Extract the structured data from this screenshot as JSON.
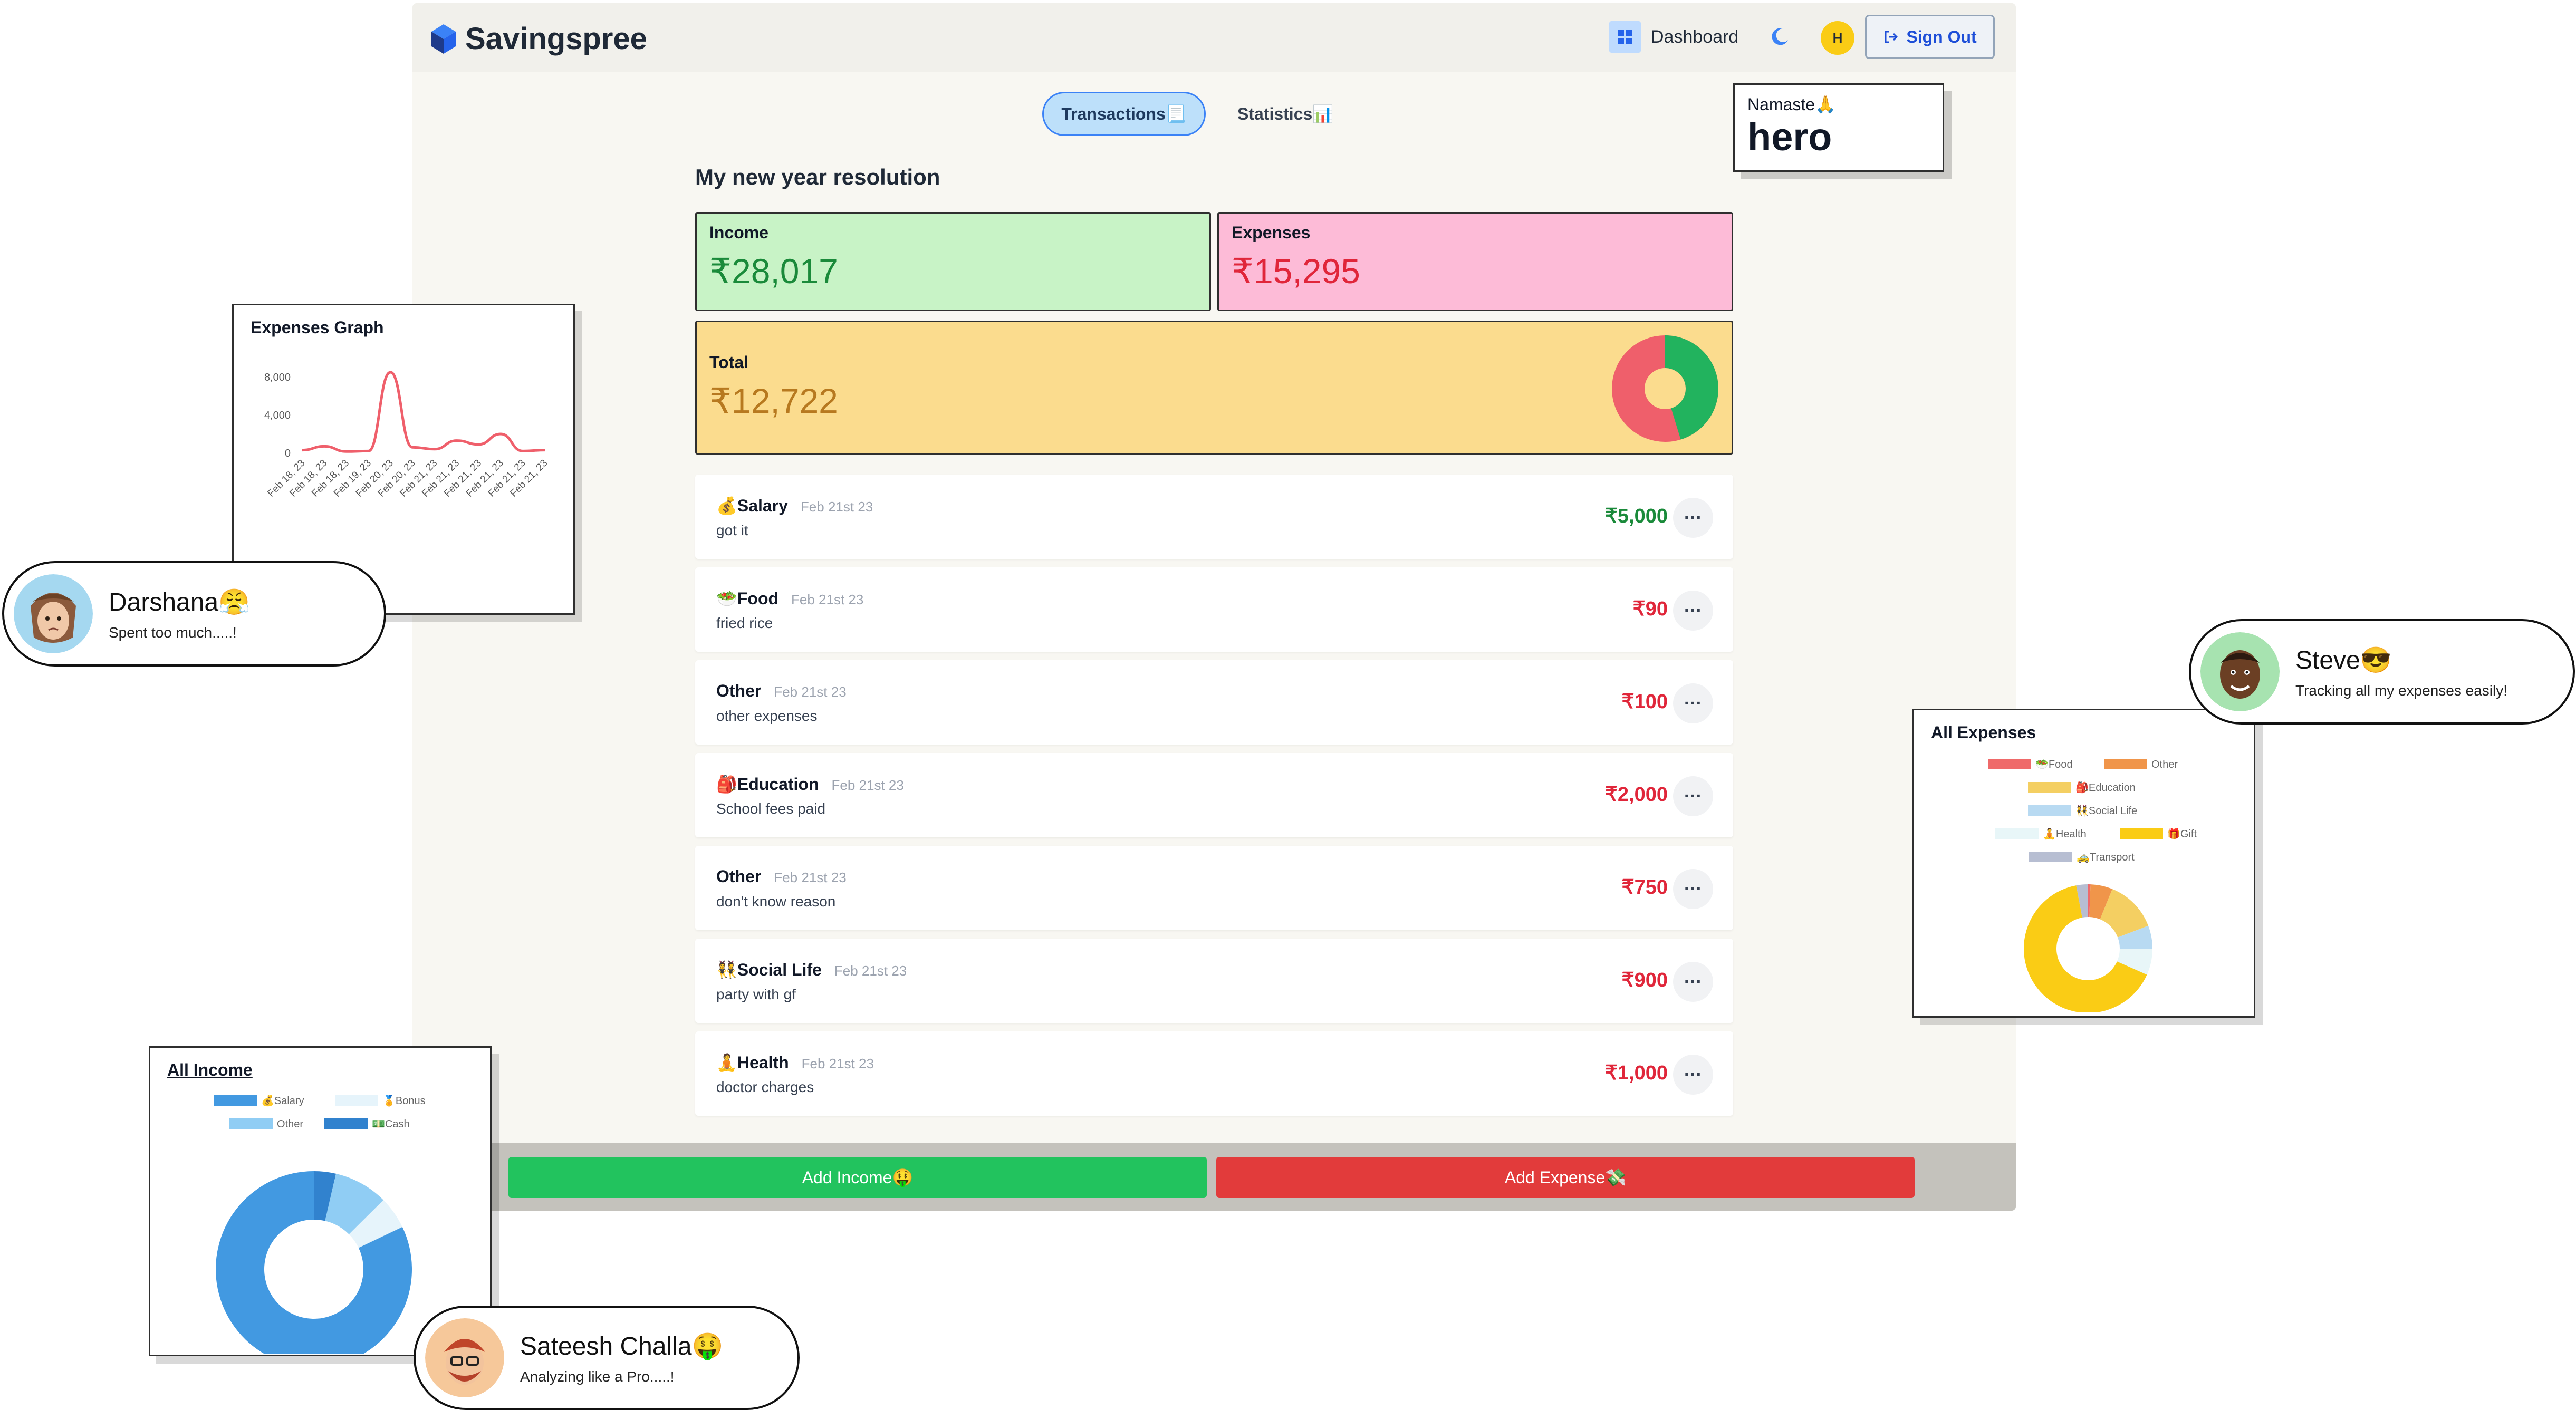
{
  "header": {
    "brand": "Savingspree",
    "dashboard_label": "Dashboard",
    "avatar_initial": "H",
    "signout_label": "Sign Out"
  },
  "tabs": [
    {
      "label": "Transactions📃",
      "active": true
    },
    {
      "label": "Statistics📊",
      "active": false
    }
  ],
  "greeting": {
    "label": "Namaste🙏",
    "name": "hero"
  },
  "page_title": "My new year resolution",
  "summary": {
    "income_label": "Income",
    "income_value": "₹28,017",
    "expenses_label": "Expenses",
    "expenses_value": "₹15,295",
    "total_label": "Total",
    "total_value": "₹12,722",
    "colors": {
      "income": "#1a8a3a",
      "expense": "#e0263a",
      "total": "#b7791f"
    }
  },
  "transactions": [
    {
      "name": "💰Salary",
      "date": "Feb 21st 23",
      "note": "got it",
      "amount": "₹5,000",
      "kind": "income"
    },
    {
      "name": "🥗Food",
      "date": "Feb 21st 23",
      "note": "fried rice",
      "amount": "₹90",
      "kind": "expense"
    },
    {
      "name": "Other",
      "date": "Feb 21st 23",
      "note": "other expenses",
      "amount": "₹100",
      "kind": "expense"
    },
    {
      "name": "🎒Education",
      "date": "Feb 21st 23",
      "note": "School fees paid",
      "amount": "₹2,000",
      "kind": "expense"
    },
    {
      "name": "Other",
      "date": "Feb 21st 23",
      "note": "don't know reason",
      "amount": "₹750",
      "kind": "expense"
    },
    {
      "name": "👯Social Life",
      "date": "Feb 21st 23",
      "note": "party with gf",
      "amount": "₹900",
      "kind": "expense"
    },
    {
      "name": "🧘Health",
      "date": "Feb 21st 23",
      "note": "doctor charges",
      "amount": "₹1,000",
      "kind": "expense"
    }
  ],
  "more_label": "···",
  "actions": {
    "add_income": "Add Income🤑",
    "add_expense": "Add Expense💸"
  },
  "expenses_graph": {
    "title": "Expenses Graph",
    "chart_data": {
      "type": "line",
      "title": "Expenses Graph",
      "x": [
        "Feb 18, 23",
        "Feb 18, 23",
        "Feb 18, 23",
        "Feb 19, 23",
        "Feb 20, 23",
        "Feb 20, 23",
        "Feb 21, 23",
        "Feb 21, 23",
        "Feb 21, 23",
        "Feb 21, 23",
        "Feb 21, 23",
        "Feb 21, 23"
      ],
      "values": [
        300,
        700,
        150,
        200,
        8500,
        600,
        400,
        1300,
        900,
        2000,
        200,
        300
      ],
      "y_ticks": [
        "8,000",
        "4,000",
        "0"
      ],
      "ylim": [
        0,
        10000
      ],
      "color": "#ef5f6b"
    }
  },
  "all_expenses": {
    "title": "All Expenses",
    "chart_data": {
      "type": "pie",
      "title": "All Expenses",
      "legend": [
        {
          "label": "🥗Food",
          "color": "#ef6a6a"
        },
        {
          "label": "Other",
          "color": "#f0954a"
        },
        {
          "label": "🎒Education",
          "color": "#f4cf62"
        },
        {
          "label": "👯Social Life",
          "color": "#b8daf2"
        },
        {
          "label": "🧘Health",
          "color": "#e8f6f8"
        },
        {
          "label": "🎁Gift",
          "color": "#facc15"
        },
        {
          "label": "🚕Transport",
          "color": "#b7bed2"
        }
      ],
      "values": [
        90,
        850,
        2000,
        900,
        1000,
        10000,
        455
      ]
    }
  },
  "all_income": {
    "title": "All Income",
    "chart_data": {
      "type": "pie",
      "title": "All Income",
      "legend": [
        {
          "label": "💰Salary",
          "color": "#4299e1"
        },
        {
          "label": "🏅Bonus",
          "color": "#e6f4fb"
        },
        {
          "label": "Other",
          "color": "#90cdf4"
        },
        {
          "label": "💵Cash",
          "color": "#3182ce"
        }
      ],
      "values": [
        23000,
        1500,
        2500,
        1017
      ]
    }
  },
  "testimonials": [
    {
      "name": "Darshana😤",
      "message": "Spent too much.....!"
    },
    {
      "name": "Steve😎",
      "message": "Tracking all my expenses easily!"
    },
    {
      "name": "Sateesh Challa🤑",
      "message": "Analyzing like a Pro.....!"
    }
  ]
}
